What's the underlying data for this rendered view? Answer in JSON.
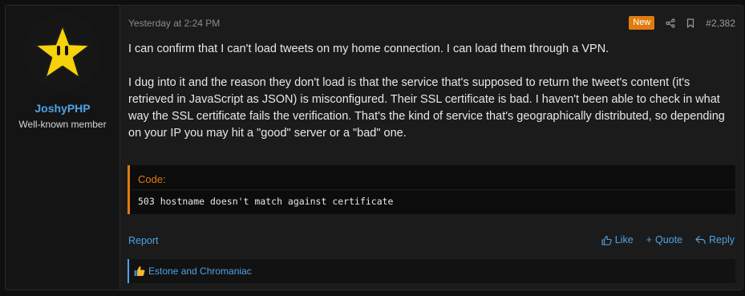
{
  "post": {
    "username": "JoshyPHP",
    "user_title": "Well-known member",
    "timestamp": "Yesterday at 2:24 PM",
    "new_badge": "New",
    "post_number": "#2,382",
    "paragraphs": [
      "I can confirm that I can't load tweets on my home connection. I can load them through a VPN.",
      "I dug into it and the reason they don't load is that the service that's supposed to return the tweet's content (it's retrieved in JavaScript as JSON) is misconfigured. Their SSL certificate is bad. I haven't been able to check in what way the SSL certificate fails the verification. That's the kind of service that's geographically distributed, so depending on your IP you may hit a \"good\" server or a \"bad\" one."
    ],
    "code": {
      "title": "Code:",
      "content": "503 hostname doesn't match against certificate"
    },
    "actions": {
      "report": "Report",
      "like": "Like",
      "quote": "Quote",
      "reply": "Reply"
    },
    "reactions_text": "Estone and Chromaniac"
  },
  "colors": {
    "accent": "#4da3e6",
    "badge": "#e07b0f",
    "background": "#1b1b1b",
    "avatar_star": "#f5d20a"
  },
  "icons": {
    "share": "share-icon",
    "bookmark": "bookmark-icon",
    "like": "thumbs-up-icon",
    "quote": "plus-icon",
    "reply": "reply-icon",
    "reaction": "thumbs-up-reaction-icon"
  }
}
